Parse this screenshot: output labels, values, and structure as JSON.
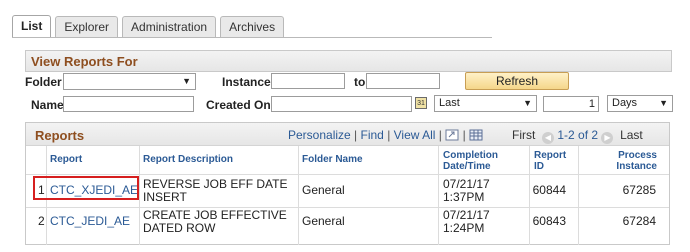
{
  "tabs": [
    "List",
    "Explorer",
    "Administration",
    "Archives"
  ],
  "view_reports": {
    "title": "View Reports For",
    "folder_label": "Folder",
    "folder_value": "",
    "instance_label": "Instance",
    "instance_from": "",
    "to_label": "to",
    "instance_to": "",
    "refresh_label": "Refresh",
    "name_label": "Name",
    "name_value": "",
    "created_on_label": "Created On",
    "created_on_value": "",
    "range_select": "Last",
    "range_count": "1",
    "range_unit": "Days"
  },
  "reports": {
    "title": "Reports",
    "personalize": "Personalize",
    "find": "Find",
    "view_all": "View All",
    "nav_first": "First",
    "nav_range": "1-2 of 2",
    "nav_last": "Last",
    "columns": {
      "report": "Report",
      "desc": "Report Description",
      "folder": "Folder Name",
      "completion_1": "Completion",
      "completion_2": "Date/Time",
      "report_id_1": "Report",
      "report_id_2": "ID",
      "process_1": "Process",
      "process_2": "Instance"
    },
    "rows": [
      {
        "num": "1",
        "report": "CTC_XJEDI_AE",
        "desc_1": "REVERSE JOB EFF DATE",
        "desc_2": "INSERT",
        "folder": "General",
        "date": "07/21/17",
        "time": "1:37PM",
        "id": "60844",
        "instance": "67285"
      },
      {
        "num": "2",
        "report": "CTC_JEDI_AE",
        "desc_1": "CREATE JOB EFFECTIVE",
        "desc_2": "DATED ROW",
        "folder": "General",
        "date": "07/21/17",
        "time": "1:24PM",
        "id": "60843",
        "instance": "67284"
      }
    ]
  },
  "colors": {
    "section_title": "#8e4e1f",
    "link": "#2b5a95",
    "highlight": "#d61f1f",
    "refresh_bg": "#f5d68a"
  },
  "icons": [
    "calendar-icon",
    "chevron-down-icon",
    "previous-icon",
    "next-icon",
    "zoom-icon",
    "download-icon"
  ]
}
